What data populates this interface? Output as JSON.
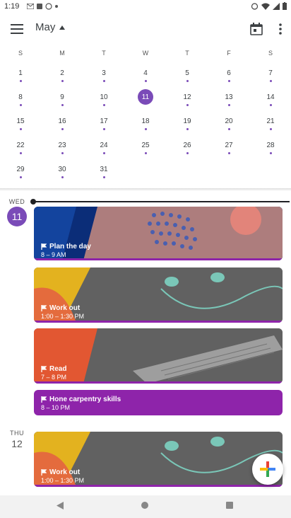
{
  "status_bar": {
    "time": "1:19"
  },
  "top_bar": {
    "month": "May"
  },
  "calendar": {
    "weekdays": [
      "S",
      "M",
      "T",
      "W",
      "T",
      "F",
      "S"
    ],
    "weeks": [
      [
        "1",
        "2",
        "3",
        "4",
        "5",
        "6",
        "7"
      ],
      [
        "8",
        "9",
        "10",
        "11",
        "12",
        "13",
        "14"
      ],
      [
        "15",
        "16",
        "17",
        "18",
        "19",
        "20",
        "21"
      ],
      [
        "22",
        "23",
        "24",
        "25",
        "26",
        "27",
        "28"
      ],
      [
        "29",
        "30",
        "31",
        "",
        "",
        "",
        ""
      ]
    ],
    "selected_day": "11",
    "accent": "#7a4bb8"
  },
  "schedule": {
    "day1": {
      "weekday": "WED",
      "date": "11"
    },
    "day2": {
      "weekday": "THU",
      "date": "12"
    },
    "events": [
      {
        "title": "Plan the day",
        "time": "8 – 9 AM"
      },
      {
        "title": "Work out",
        "time": "1:00 – 1:30 PM"
      },
      {
        "title": "Read",
        "time": "7 – 8 PM"
      },
      {
        "title": "Hone carpentry skills",
        "time": "8 – 10 PM"
      },
      {
        "title": "Work out",
        "time": "1:00 – 1:30 PM"
      }
    ]
  },
  "icons": {
    "menu": "hamburger-icon",
    "dropdown": "triangle-up-icon",
    "today": "calendar-today-icon",
    "more": "more-vert-icon",
    "event_flag": "flag-icon",
    "fab": "plus-icon"
  }
}
